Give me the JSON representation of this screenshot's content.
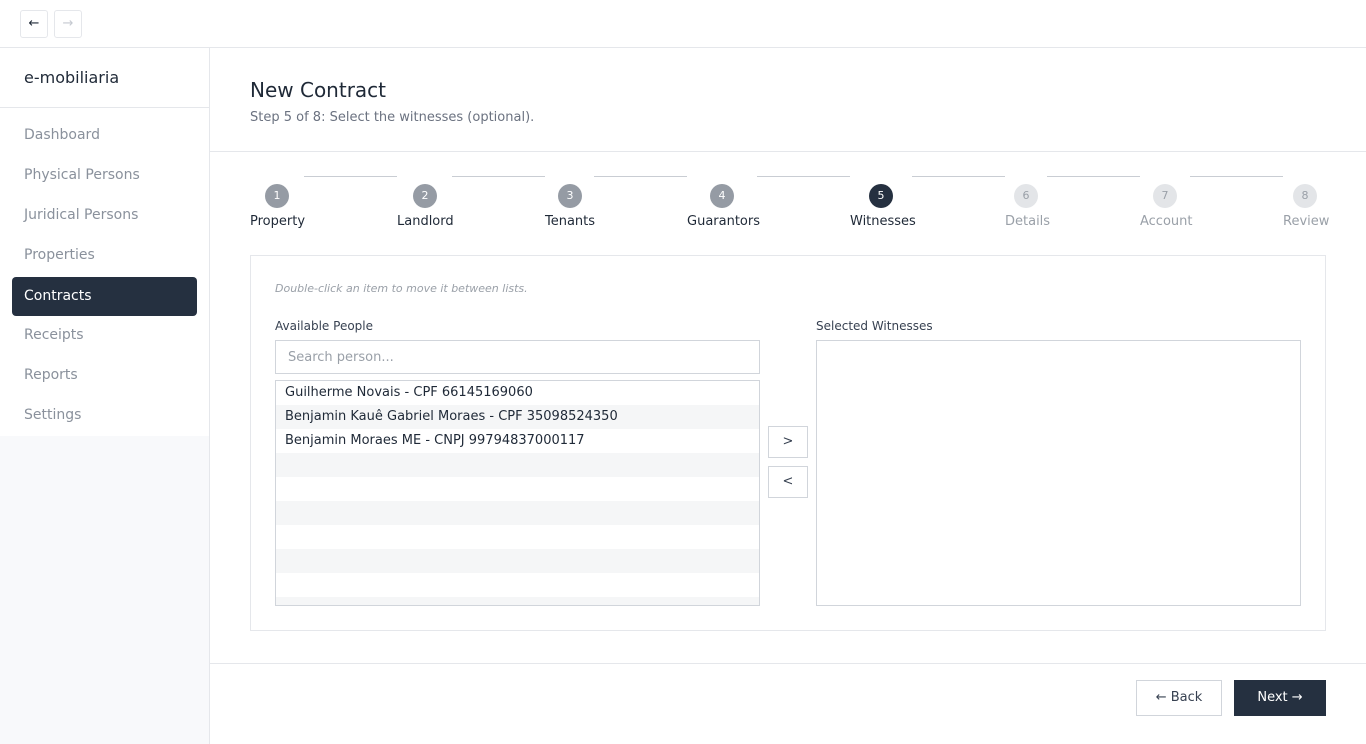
{
  "topbar": {
    "back_icon": "←",
    "forward_icon": "→"
  },
  "sidebar": {
    "brand": "e-mobiliaria",
    "items": [
      {
        "label": "Dashboard",
        "active": false
      },
      {
        "label": "Physical Persons",
        "active": false
      },
      {
        "label": "Juridical Persons",
        "active": false
      },
      {
        "label": "Properties",
        "active": false
      },
      {
        "label": "Contracts",
        "active": true
      },
      {
        "label": "Receipts",
        "active": false
      },
      {
        "label": "Reports",
        "active": false
      },
      {
        "label": "Settings",
        "active": false
      }
    ]
  },
  "header": {
    "title": "New Contract",
    "subtitle": "Step 5 of 8: Select the witnesses (optional)."
  },
  "stepper": {
    "steps": [
      {
        "number": "1",
        "label": "Property",
        "state": "done"
      },
      {
        "number": "2",
        "label": "Landlord",
        "state": "done"
      },
      {
        "number": "3",
        "label": "Tenants",
        "state": "done"
      },
      {
        "number": "4",
        "label": "Guarantors",
        "state": "done"
      },
      {
        "number": "5",
        "label": "Witnesses",
        "state": "active"
      },
      {
        "number": "6",
        "label": "Details",
        "state": "todo"
      },
      {
        "number": "7",
        "label": "Account",
        "state": "todo"
      },
      {
        "number": "8",
        "label": "Review",
        "state": "todo"
      }
    ]
  },
  "panel": {
    "hint": "Double-click an item to move it between lists.",
    "available_label": "Available People",
    "search_placeholder": "Search person...",
    "available_people": [
      "Guilherme Novais - CPF 66145169060",
      "Benjamin Kauê Gabriel Moraes - CPF 35098524350",
      "Benjamin Moraes ME - CNPJ 99794837000117"
    ],
    "selected_label": "Selected Witnesses",
    "selected_witnesses": [],
    "move_right": ">",
    "move_left": "<"
  },
  "footer": {
    "back_label": "← Back",
    "next_label": "Next →"
  },
  "colors": {
    "accent": "#253040",
    "step_done": "#959ba4",
    "step_todo": "#e3e5e8",
    "muted_text": "#8a919c"
  }
}
